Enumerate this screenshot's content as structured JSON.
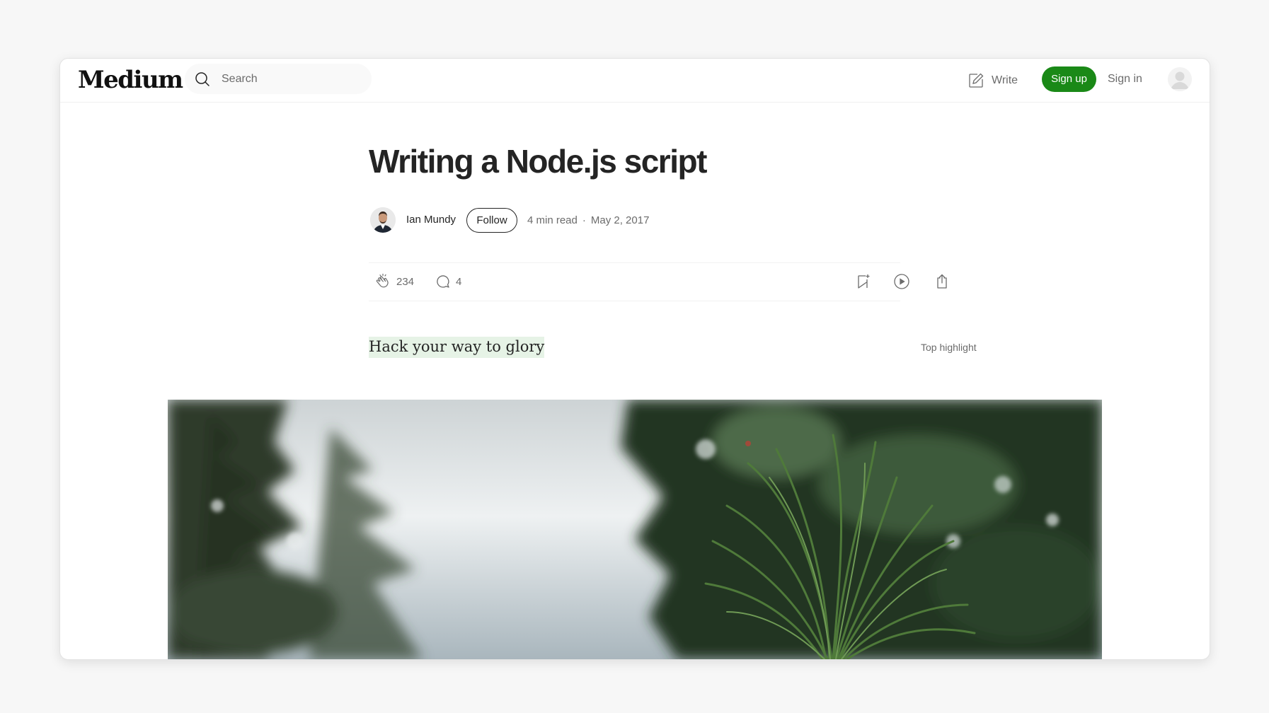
{
  "nav": {
    "logo": "Medium",
    "search_placeholder": "Search",
    "write_label": "Write",
    "signup_label": "Sign up",
    "signin_label": "Sign in"
  },
  "article": {
    "title": "Writing a Node.js script",
    "author": "Ian Mundy",
    "follow_label": "Follow",
    "read_time": "4 min read",
    "separator": "·",
    "date": "May 2, 2017",
    "claps": "234",
    "responses": "4",
    "subtitle": "Hack your way to glory",
    "top_highlight_label": "Top highlight"
  },
  "colors": {
    "brand_green": "#1a8917",
    "highlight": "#e6f3e6",
    "text": "#242424",
    "muted": "#6b6b6b"
  },
  "icons": {
    "search": "search-icon",
    "write": "write-icon",
    "clap": "clap-icon",
    "comment": "comment-icon",
    "bookmark": "bookmark-add-icon",
    "listen": "play-icon",
    "share": "share-icon"
  }
}
